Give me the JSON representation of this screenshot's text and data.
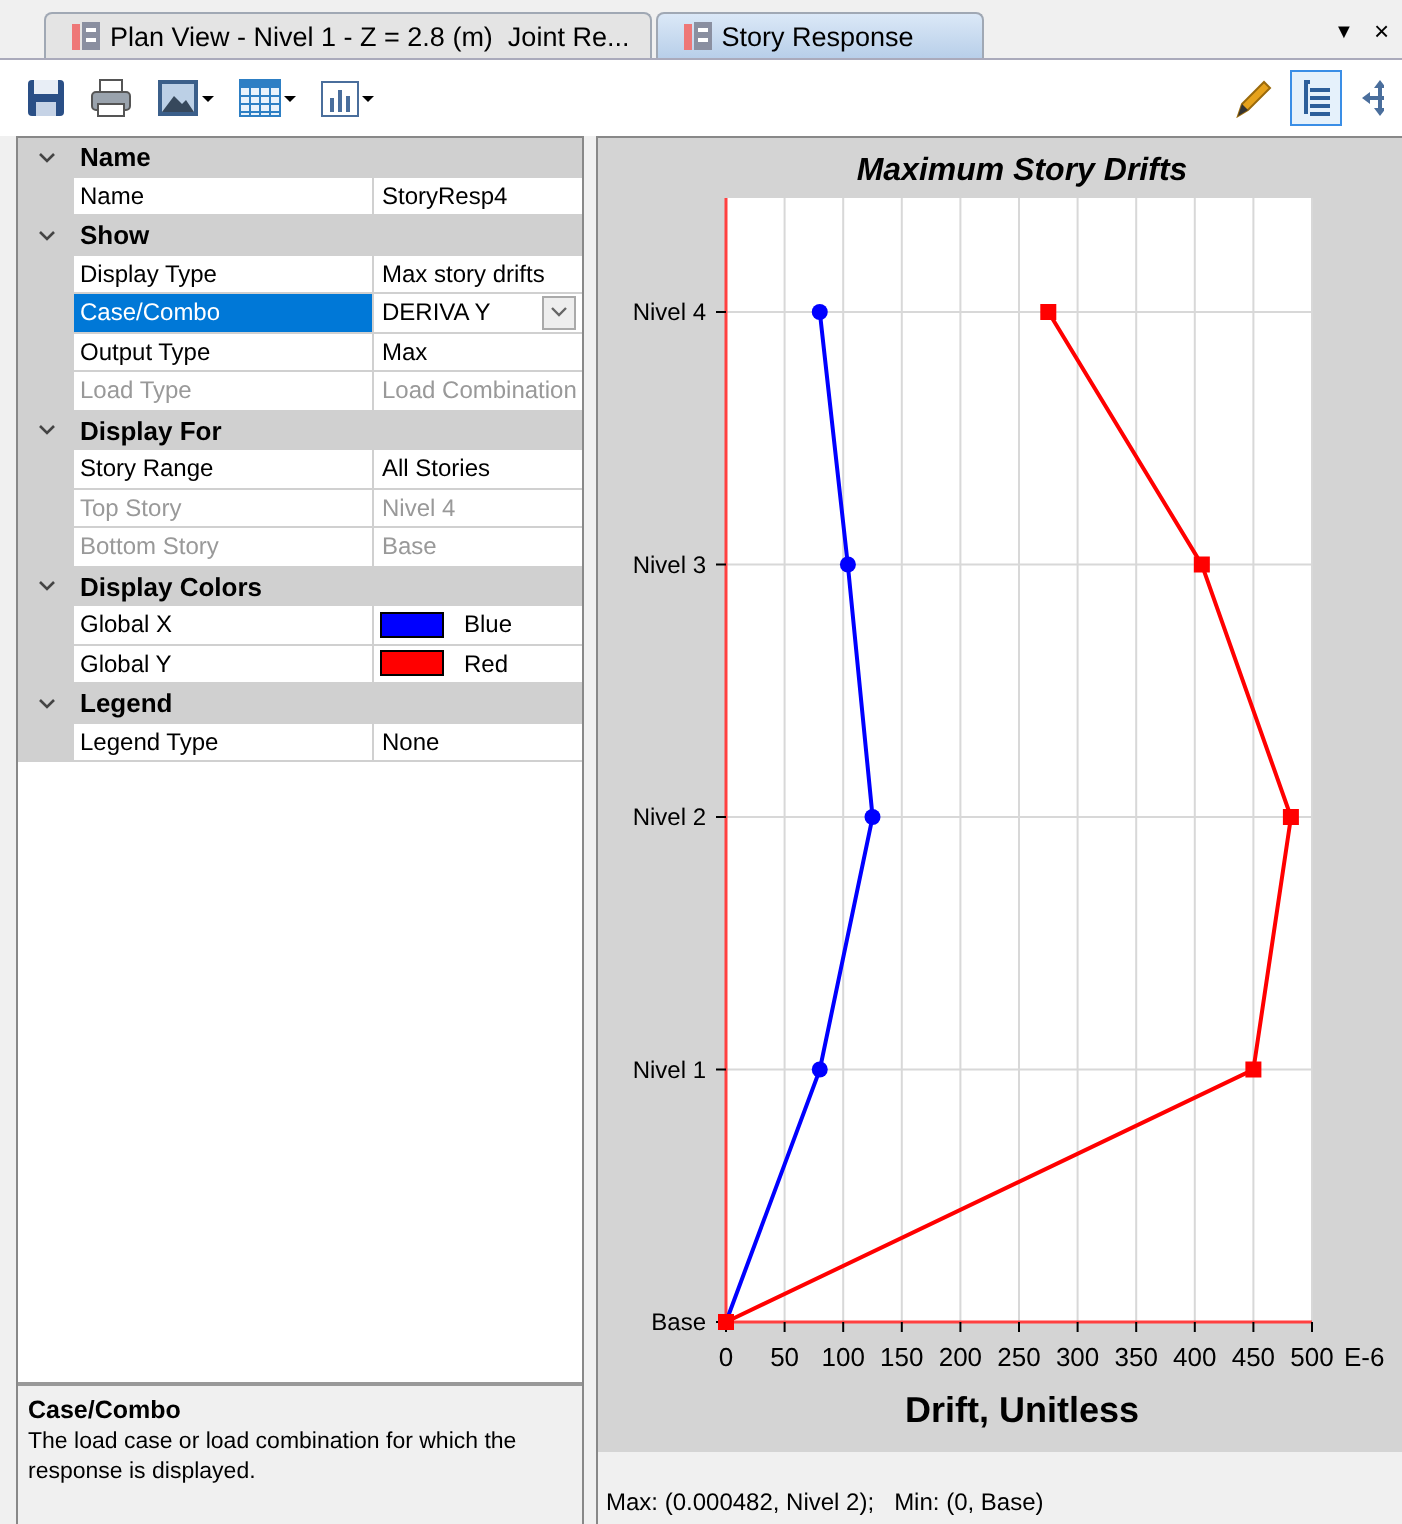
{
  "tabs": [
    {
      "label": "Plan View - Nivel 1 - Z = 2.8 (m)  Joint Re...",
      "selected": false
    },
    {
      "label": "Story Response",
      "selected": true
    }
  ],
  "tab_controls": [
    "▼",
    "×"
  ],
  "toolbar": {
    "left_tools": [
      {
        "kind": "save",
        "dropdown": false
      },
      {
        "kind": "print",
        "dropdown": false
      },
      {
        "kind": "picture",
        "dropdown": true
      },
      {
        "kind": "table",
        "dropdown": true
      },
      {
        "kind": "chart",
        "dropdown": true
      }
    ],
    "right_tools": [
      {
        "kind": "pencil",
        "selected": false
      },
      {
        "kind": "tree",
        "selected": true
      },
      {
        "kind": "move",
        "selected": false
      }
    ]
  },
  "property_grid": {
    "categories": [
      {
        "label": "Name",
        "expanded": true,
        "rows": [
          {
            "kind": "text",
            "label": "Name",
            "value": "StoryResp4",
            "selected": false,
            "disabled": false
          }
        ]
      },
      {
        "label": "Show",
        "expanded": true,
        "rows": [
          {
            "kind": "text",
            "label": "Display Type",
            "value": "Max story drifts",
            "selected": false,
            "disabled": false
          },
          {
            "kind": "dropdown",
            "label": "Case/Combo",
            "value": "DERIVA Y",
            "selected": true,
            "disabled": false
          },
          {
            "kind": "text",
            "label": "Output Type",
            "value": "Max",
            "selected": false,
            "disabled": false
          },
          {
            "kind": "text",
            "label": "Load Type",
            "value": "Load Combination",
            "selected": false,
            "disabled": true
          }
        ]
      },
      {
        "label": "Display For",
        "expanded": true,
        "rows": [
          {
            "kind": "text",
            "label": "Story Range",
            "value": "All Stories",
            "selected": false,
            "disabled": false
          },
          {
            "kind": "text",
            "label": "Top Story",
            "value": "Nivel 4",
            "selected": false,
            "disabled": true
          },
          {
            "kind": "text",
            "label": "Bottom Story",
            "value": "Base",
            "selected": false,
            "disabled": true
          }
        ]
      },
      {
        "label": "Display Colors",
        "expanded": true,
        "rows": [
          {
            "kind": "color",
            "label": "Global X",
            "value": "Blue",
            "color": "#0000ff",
            "selected": false,
            "disabled": false
          },
          {
            "kind": "color",
            "label": "Global Y",
            "value": "Red",
            "color": "#ff0000",
            "selected": false,
            "disabled": false
          }
        ]
      },
      {
        "label": "Legend",
        "expanded": true,
        "rows": [
          {
            "kind": "text",
            "label": "Legend Type",
            "value": "None",
            "selected": false,
            "disabled": false
          }
        ]
      }
    ]
  },
  "description": {
    "title": "Case/Combo",
    "text": "The load case or load combination for which the response is displayed."
  },
  "chart": {
    "axis_unit": "E-6",
    "chart_data": {
      "type": "line",
      "orientation": "horizontal",
      "title": "Maximum Story Drifts",
      "xlabel": "Drift, Unitless",
      "categories": [
        "Nivel 4",
        "Nivel 3",
        "Nivel 2",
        "Nivel 1",
        "Base"
      ],
      "xlim": [
        0,
        500
      ],
      "xticks": [
        0,
        50,
        100,
        150,
        200,
        250,
        300,
        350,
        400,
        450,
        500
      ],
      "grid": true,
      "series": [
        {
          "color": "#0000ff",
          "marker": "circle",
          "values": [
            80,
            104,
            125,
            80,
            0
          ]
        },
        {
          "color": "#ff0000",
          "marker": "square",
          "values": [
            275,
            406,
            482,
            450,
            0
          ]
        }
      ]
    }
  },
  "status_bar": "Max: (0.000482, Nivel 2);   Min: (0, Base)"
}
